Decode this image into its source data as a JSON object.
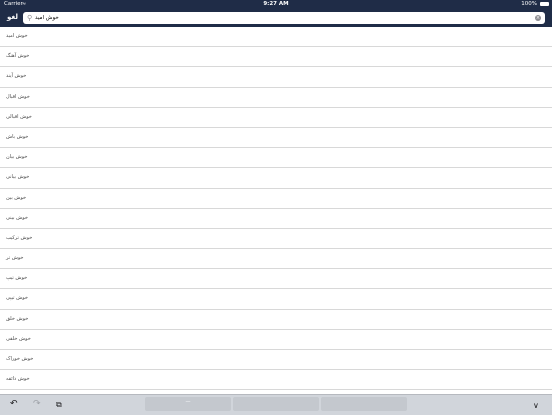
{
  "status_bar": {
    "carrier": "Carrier",
    "time": "9:27 AM",
    "battery": "100%"
  },
  "nav": {
    "cancel_label": "لغو",
    "search_value": "خوش امید"
  },
  "results": [
    "خوش امید",
    "خوش آهنگ",
    "خوش آیند",
    "خوش اقبال",
    "خوش اقبالی",
    "خوش باش",
    "خوش بیان",
    "خوش بیانی",
    "خوش بین",
    "خوش بینی",
    "خوش ترکیب",
    "خوش تر",
    "خوش تیپ",
    "خوش تیپی",
    "خوش خلق",
    "خوش خلقی",
    "خوش خوراک",
    "خوش ذائقه"
  ],
  "keyboard": {
    "suggestion_placeholder": "—"
  }
}
